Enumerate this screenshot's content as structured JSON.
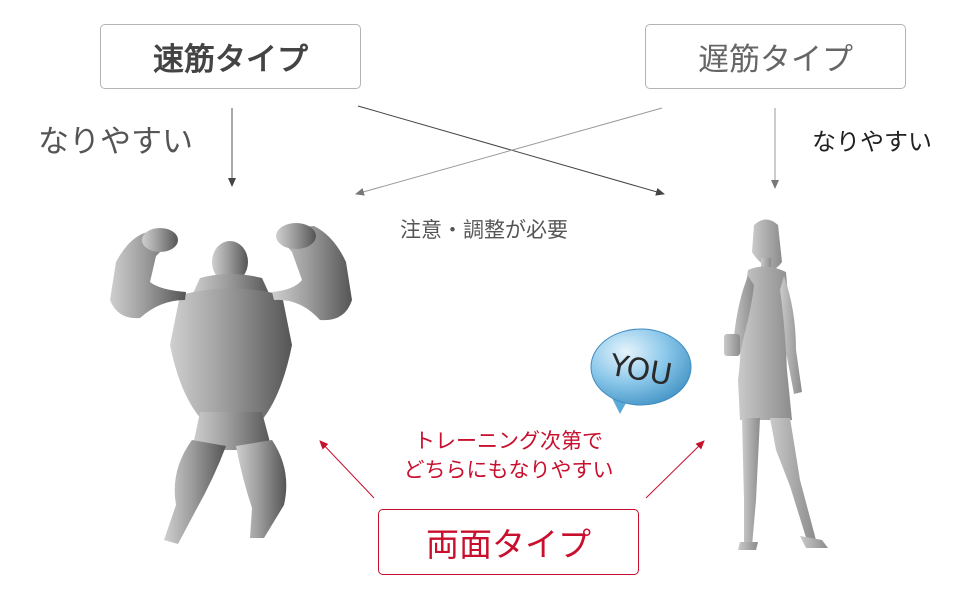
{
  "boxes": {
    "fast_type": "速筋タイプ",
    "slow_type": "遅筋タイプ",
    "both_type": "両面タイプ"
  },
  "labels": {
    "left_likely": "なりやすい",
    "right_likely": "なりやすい",
    "caution": "注意・調整が必要",
    "training_line1": "トレーニング次第で",
    "training_line2": "どちらにもなりやすい"
  },
  "bubble": {
    "text": "YOU"
  },
  "colors": {
    "accent_red": "#c8102e",
    "arrow_gray": "#888888",
    "bubble_blue": "#5aa9d6"
  },
  "icons": {
    "left_figure": "bodybuilder-silhouette-icon",
    "right_figure": "woman-silhouette-icon",
    "bubble": "speech-bubble-icon"
  }
}
